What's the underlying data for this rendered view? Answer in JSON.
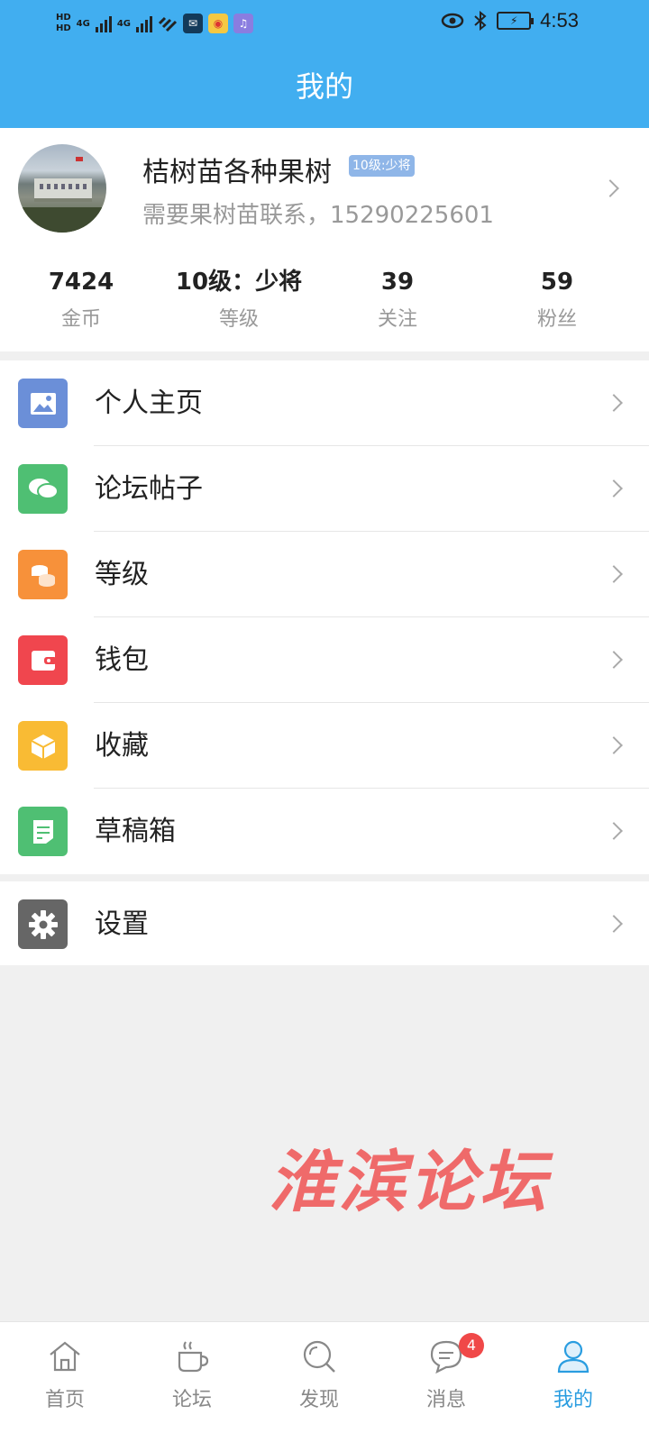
{
  "status_bar": {
    "hd1": "HD",
    "hd2": "HD",
    "net1": "4G",
    "net2": "4G",
    "time": "4:53",
    "icons": [
      "signal-icon",
      "wifi-icon",
      "mail-icon",
      "weibo-icon",
      "music-icon",
      "eye-icon",
      "bluetooth-icon",
      "battery-icon"
    ]
  },
  "header": {
    "title": "我的"
  },
  "profile": {
    "name": "桔树苗各种果树",
    "level_badge": "10级:少将",
    "signature": "需要果树苗联系，15290225601"
  },
  "stats": [
    {
      "value": "7424",
      "label": "金币"
    },
    {
      "value": "10级：少将",
      "label": "等级"
    },
    {
      "value": "39",
      "label": "关注"
    },
    {
      "value": "59",
      "label": "粉丝"
    }
  ],
  "menu": [
    {
      "label": "个人主页",
      "icon": "image-icon",
      "color": "#6b8fd8"
    },
    {
      "label": "论坛帖子",
      "icon": "chat-icon",
      "color": "#4fbf73"
    },
    {
      "label": "等级",
      "icon": "coins-icon",
      "color": "#f7913a"
    },
    {
      "label": "钱包",
      "icon": "wallet-icon",
      "color": "#f0464e"
    },
    {
      "label": "收藏",
      "icon": "box-icon",
      "color": "#f9bb34"
    },
    {
      "label": "草稿箱",
      "icon": "draft-icon",
      "color": "#4fbf73"
    }
  ],
  "settings": {
    "label": "设置",
    "icon": "gear-icon",
    "color": "#666666"
  },
  "watermark": "淮滨论坛",
  "tabs": [
    {
      "label": "首页",
      "icon": "home-icon"
    },
    {
      "label": "论坛",
      "icon": "coffee-icon"
    },
    {
      "label": "发现",
      "icon": "search-icon"
    },
    {
      "label": "消息",
      "icon": "message-icon",
      "badge": "4"
    },
    {
      "label": "我的",
      "icon": "user-icon",
      "active": true
    }
  ],
  "colors": {
    "primary": "#41aef0",
    "active_tab": "#2a9de0",
    "badge": "#f04848"
  }
}
